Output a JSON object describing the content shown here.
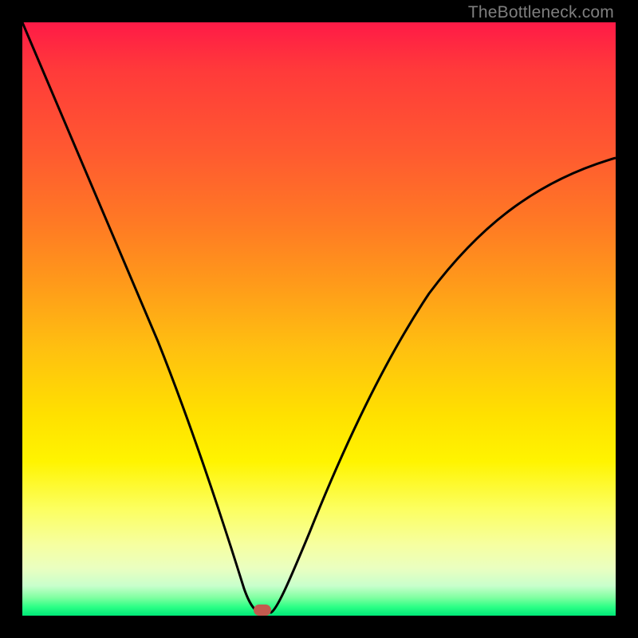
{
  "watermark": "TheBottleneck.com",
  "marker": {
    "x_pct": 40.5,
    "y_pct": 99.0,
    "color": "#c35a4f"
  },
  "chart_data": {
    "type": "line",
    "title": "",
    "xlabel": "",
    "ylabel": "",
    "xlim": [
      0,
      100
    ],
    "ylim": [
      0,
      100
    ],
    "grid": false,
    "legend": false,
    "series": [
      {
        "name": "bottleneck-curve",
        "x": [
          0,
          5,
          10,
          15,
          20,
          25,
          30,
          35,
          37,
          39,
          40,
          41,
          42,
          45,
          50,
          55,
          60,
          65,
          70,
          75,
          80,
          85,
          90,
          95,
          100
        ],
        "y": [
          100,
          88,
          76,
          64,
          51,
          38,
          25,
          11,
          4,
          0,
          0,
          0,
          1,
          6,
          17,
          29,
          40,
          49,
          57,
          63,
          68,
          71,
          74,
          76,
          77
        ]
      }
    ],
    "annotations": [
      {
        "type": "marker",
        "x": 40.5,
        "y": 0,
        "label": "optimal-point"
      }
    ],
    "background_gradient_stops": [
      {
        "pos": 0.0,
        "color": "#ff1a47"
      },
      {
        "pos": 0.08,
        "color": "#ff3a3a"
      },
      {
        "pos": 0.22,
        "color": "#ff5a30"
      },
      {
        "pos": 0.34,
        "color": "#ff7a24"
      },
      {
        "pos": 0.44,
        "color": "#ff9a1a"
      },
      {
        "pos": 0.55,
        "color": "#ffc010"
      },
      {
        "pos": 0.66,
        "color": "#ffe000"
      },
      {
        "pos": 0.74,
        "color": "#fff400"
      },
      {
        "pos": 0.82,
        "color": "#fcff60"
      },
      {
        "pos": 0.88,
        "color": "#f6ffa0"
      },
      {
        "pos": 0.92,
        "color": "#eaffc0"
      },
      {
        "pos": 0.95,
        "color": "#c8ffcc"
      },
      {
        "pos": 0.97,
        "color": "#7effa0"
      },
      {
        "pos": 0.985,
        "color": "#2dff86"
      },
      {
        "pos": 1.0,
        "color": "#00e878"
      }
    ]
  }
}
